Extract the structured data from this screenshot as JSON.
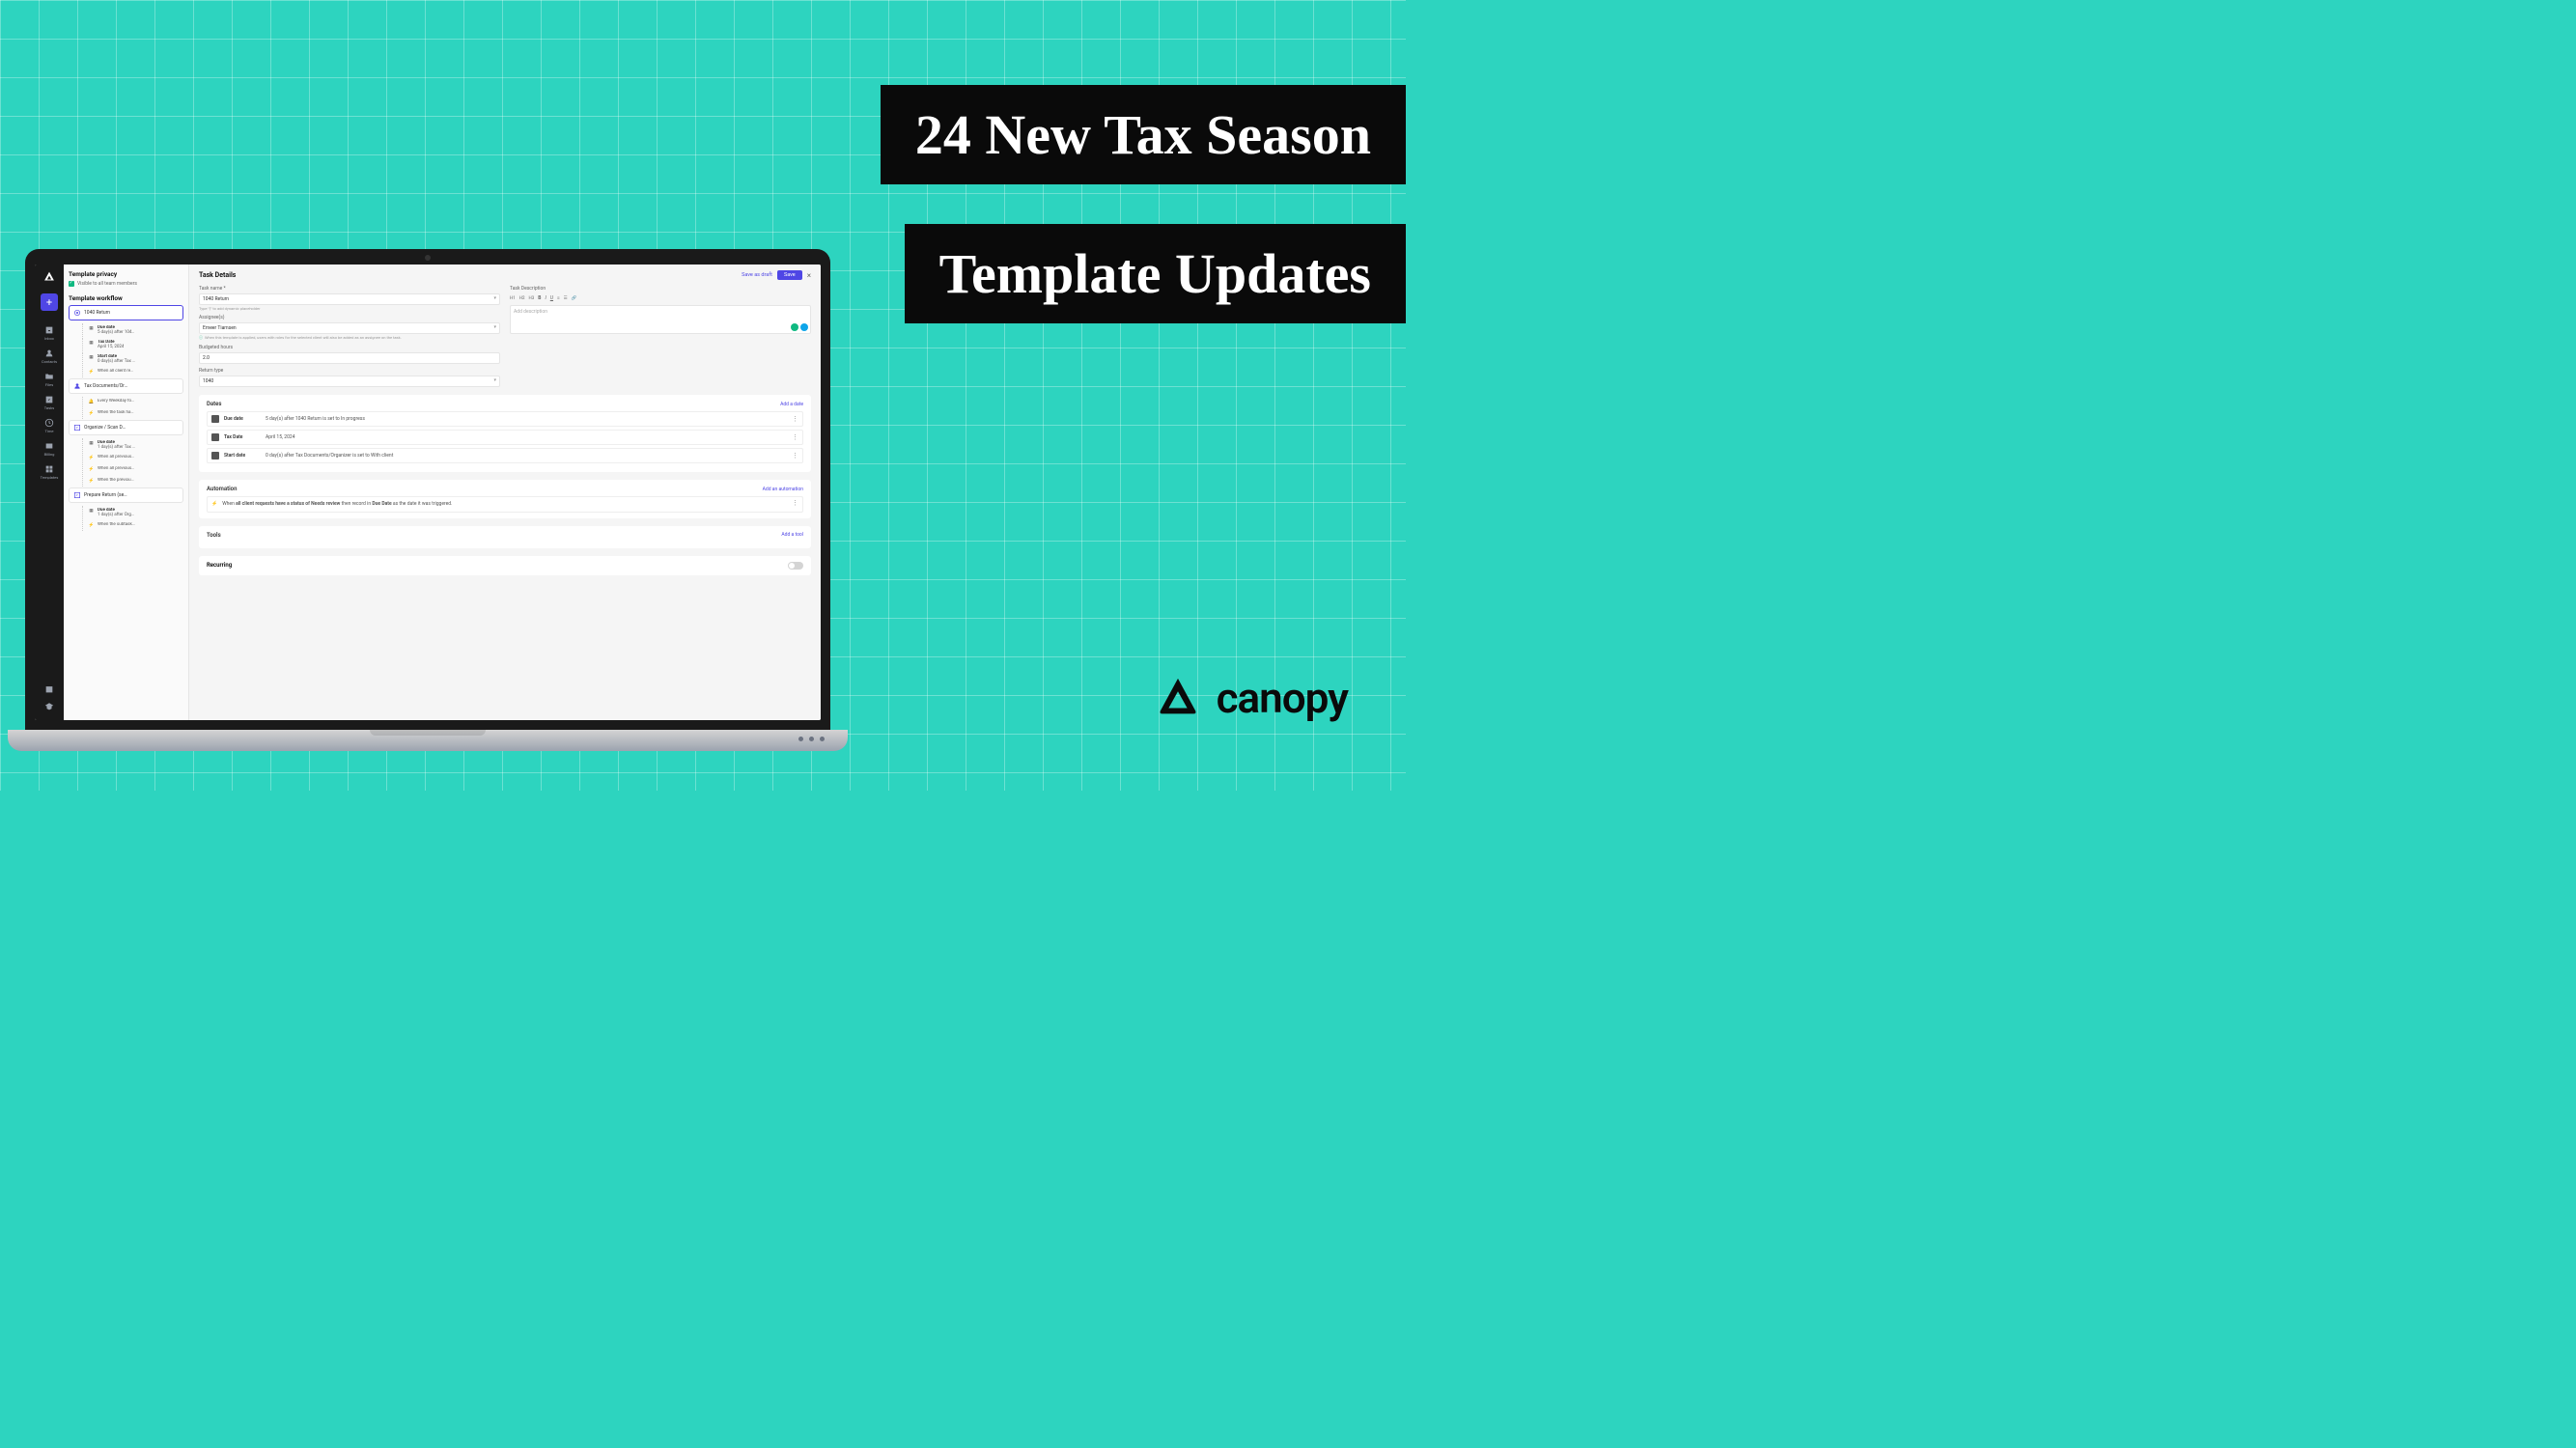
{
  "titles": {
    "line1": "24 New Tax Season",
    "line2": "Template Updates"
  },
  "brand": {
    "name": "canopy"
  },
  "sidebar": {
    "items": [
      {
        "label": "Inbox"
      },
      {
        "label": "Contacts"
      },
      {
        "label": "Files"
      },
      {
        "label": "Tasks"
      },
      {
        "label": "Time"
      },
      {
        "label": "Billing"
      },
      {
        "label": "Templates"
      }
    ]
  },
  "leftPanel": {
    "privacyHeading": "Template privacy",
    "visibilityLabel": "Visible to all team members",
    "workflowHeading": "Template workflow",
    "node1": {
      "title": "1040 Return",
      "dueLabel": "Due date",
      "dueVal": "5 day(s) after 104…",
      "taxLabel": "Tax Date",
      "taxVal": "April 15, 2024",
      "startLabel": "Start date",
      "startVal": "0 day(s) after Tax …",
      "when1": "When all client re…"
    },
    "node2": {
      "title": "Tax Documents/Or…",
      "sub1": "Every Weekday fo…",
      "sub2": "When the task ha…"
    },
    "node3": {
      "title": "Organize / Scan D…",
      "dueLabel": "Due date",
      "dueVal": "1 day(s) after Tax …",
      "w1": "When all previous…",
      "w2": "When all previous…",
      "w3": "When the previou…"
    },
    "node4": {
      "title": "Prepare Return (se…",
      "dueLabel": "Due date",
      "dueVal": "1 day(s) after Org…",
      "w1": "When the subtask…"
    }
  },
  "main": {
    "heading": "Task Details",
    "saveDraft": "Save as draft",
    "save": "Save",
    "taskNameLabel": "Task name *",
    "taskNameValue": "1040 Return",
    "taskNameHint": "Type \"{\" to add dynamic placeholder",
    "assigneeLabel": "Assignee(s)",
    "assigneeValue": "Emeer Tiamsen",
    "assigneeHint": "When this template is applied, users with roles for the selected client will also be added as an assignee on the task.",
    "budgetLabel": "Budgeted hours",
    "budgetValue": "2.0",
    "returnLabel": "Return type",
    "returnValue": "1040",
    "descLabel": "Task Description",
    "descPlaceholder": "Add description",
    "rte": {
      "h1": "H1",
      "h2": "H2",
      "h3": "H3"
    }
  },
  "dates": {
    "heading": "Dates",
    "addLink": "Add a date",
    "rows": [
      {
        "name": "Due date",
        "val": "5 day(s) after 1040 Return is set to In progress"
      },
      {
        "name": "Tax Date",
        "val": "April 15, 2024"
      },
      {
        "name": "Start date",
        "val": "0 day(s) after Tax Documents/Organizer is set to With client"
      }
    ]
  },
  "automation": {
    "heading": "Automation",
    "addLink": "Add an automation",
    "ruleP1": "When ",
    "ruleB1": "all client requests have a status of Needs review",
    "ruleP2": " then record in ",
    "ruleB2": "Due Date",
    "ruleP3": " as the date it was triggered."
  },
  "tools": {
    "heading": "Tools",
    "addLink": "Add a tool"
  },
  "recurring": {
    "heading": "Recurring"
  }
}
